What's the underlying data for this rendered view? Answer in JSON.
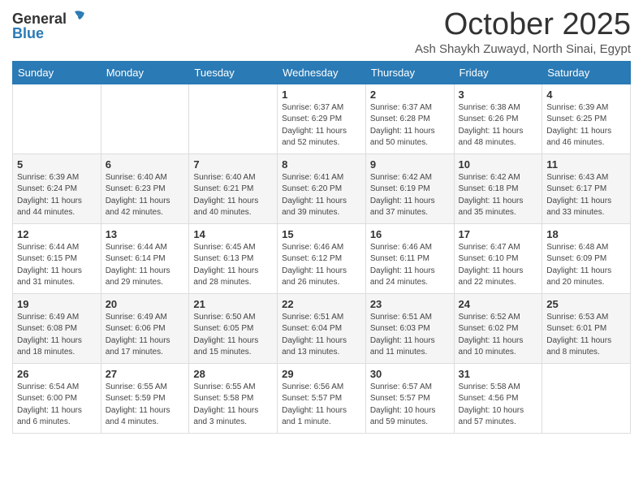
{
  "logo": {
    "general": "General",
    "blue": "Blue"
  },
  "title": "October 2025",
  "subtitle": "Ash Shaykh Zuwayd, North Sinai, Egypt",
  "days_header": [
    "Sunday",
    "Monday",
    "Tuesday",
    "Wednesday",
    "Thursday",
    "Friday",
    "Saturday"
  ],
  "weeks": [
    [
      {
        "num": "",
        "info": ""
      },
      {
        "num": "",
        "info": ""
      },
      {
        "num": "",
        "info": ""
      },
      {
        "num": "1",
        "info": "Sunrise: 6:37 AM\nSunset: 6:29 PM\nDaylight: 11 hours\nand 52 minutes."
      },
      {
        "num": "2",
        "info": "Sunrise: 6:37 AM\nSunset: 6:28 PM\nDaylight: 11 hours\nand 50 minutes."
      },
      {
        "num": "3",
        "info": "Sunrise: 6:38 AM\nSunset: 6:26 PM\nDaylight: 11 hours\nand 48 minutes."
      },
      {
        "num": "4",
        "info": "Sunrise: 6:39 AM\nSunset: 6:25 PM\nDaylight: 11 hours\nand 46 minutes."
      }
    ],
    [
      {
        "num": "5",
        "info": "Sunrise: 6:39 AM\nSunset: 6:24 PM\nDaylight: 11 hours\nand 44 minutes."
      },
      {
        "num": "6",
        "info": "Sunrise: 6:40 AM\nSunset: 6:23 PM\nDaylight: 11 hours\nand 42 minutes."
      },
      {
        "num": "7",
        "info": "Sunrise: 6:40 AM\nSunset: 6:21 PM\nDaylight: 11 hours\nand 40 minutes."
      },
      {
        "num": "8",
        "info": "Sunrise: 6:41 AM\nSunset: 6:20 PM\nDaylight: 11 hours\nand 39 minutes."
      },
      {
        "num": "9",
        "info": "Sunrise: 6:42 AM\nSunset: 6:19 PM\nDaylight: 11 hours\nand 37 minutes."
      },
      {
        "num": "10",
        "info": "Sunrise: 6:42 AM\nSunset: 6:18 PM\nDaylight: 11 hours\nand 35 minutes."
      },
      {
        "num": "11",
        "info": "Sunrise: 6:43 AM\nSunset: 6:17 PM\nDaylight: 11 hours\nand 33 minutes."
      }
    ],
    [
      {
        "num": "12",
        "info": "Sunrise: 6:44 AM\nSunset: 6:15 PM\nDaylight: 11 hours\nand 31 minutes."
      },
      {
        "num": "13",
        "info": "Sunrise: 6:44 AM\nSunset: 6:14 PM\nDaylight: 11 hours\nand 29 minutes."
      },
      {
        "num": "14",
        "info": "Sunrise: 6:45 AM\nSunset: 6:13 PM\nDaylight: 11 hours\nand 28 minutes."
      },
      {
        "num": "15",
        "info": "Sunrise: 6:46 AM\nSunset: 6:12 PM\nDaylight: 11 hours\nand 26 minutes."
      },
      {
        "num": "16",
        "info": "Sunrise: 6:46 AM\nSunset: 6:11 PM\nDaylight: 11 hours\nand 24 minutes."
      },
      {
        "num": "17",
        "info": "Sunrise: 6:47 AM\nSunset: 6:10 PM\nDaylight: 11 hours\nand 22 minutes."
      },
      {
        "num": "18",
        "info": "Sunrise: 6:48 AM\nSunset: 6:09 PM\nDaylight: 11 hours\nand 20 minutes."
      }
    ],
    [
      {
        "num": "19",
        "info": "Sunrise: 6:49 AM\nSunset: 6:08 PM\nDaylight: 11 hours\nand 18 minutes."
      },
      {
        "num": "20",
        "info": "Sunrise: 6:49 AM\nSunset: 6:06 PM\nDaylight: 11 hours\nand 17 minutes."
      },
      {
        "num": "21",
        "info": "Sunrise: 6:50 AM\nSunset: 6:05 PM\nDaylight: 11 hours\nand 15 minutes."
      },
      {
        "num": "22",
        "info": "Sunrise: 6:51 AM\nSunset: 6:04 PM\nDaylight: 11 hours\nand 13 minutes."
      },
      {
        "num": "23",
        "info": "Sunrise: 6:51 AM\nSunset: 6:03 PM\nDaylight: 11 hours\nand 11 minutes."
      },
      {
        "num": "24",
        "info": "Sunrise: 6:52 AM\nSunset: 6:02 PM\nDaylight: 11 hours\nand 10 minutes."
      },
      {
        "num": "25",
        "info": "Sunrise: 6:53 AM\nSunset: 6:01 PM\nDaylight: 11 hours\nand 8 minutes."
      }
    ],
    [
      {
        "num": "26",
        "info": "Sunrise: 6:54 AM\nSunset: 6:00 PM\nDaylight: 11 hours\nand 6 minutes."
      },
      {
        "num": "27",
        "info": "Sunrise: 6:55 AM\nSunset: 5:59 PM\nDaylight: 11 hours\nand 4 minutes."
      },
      {
        "num": "28",
        "info": "Sunrise: 6:55 AM\nSunset: 5:58 PM\nDaylight: 11 hours\nand 3 minutes."
      },
      {
        "num": "29",
        "info": "Sunrise: 6:56 AM\nSunset: 5:57 PM\nDaylight: 11 hours\nand 1 minute."
      },
      {
        "num": "30",
        "info": "Sunrise: 6:57 AM\nSunset: 5:57 PM\nDaylight: 10 hours\nand 59 minutes."
      },
      {
        "num": "31",
        "info": "Sunrise: 5:58 AM\nSunset: 4:56 PM\nDaylight: 10 hours\nand 57 minutes."
      },
      {
        "num": "",
        "info": ""
      }
    ]
  ]
}
